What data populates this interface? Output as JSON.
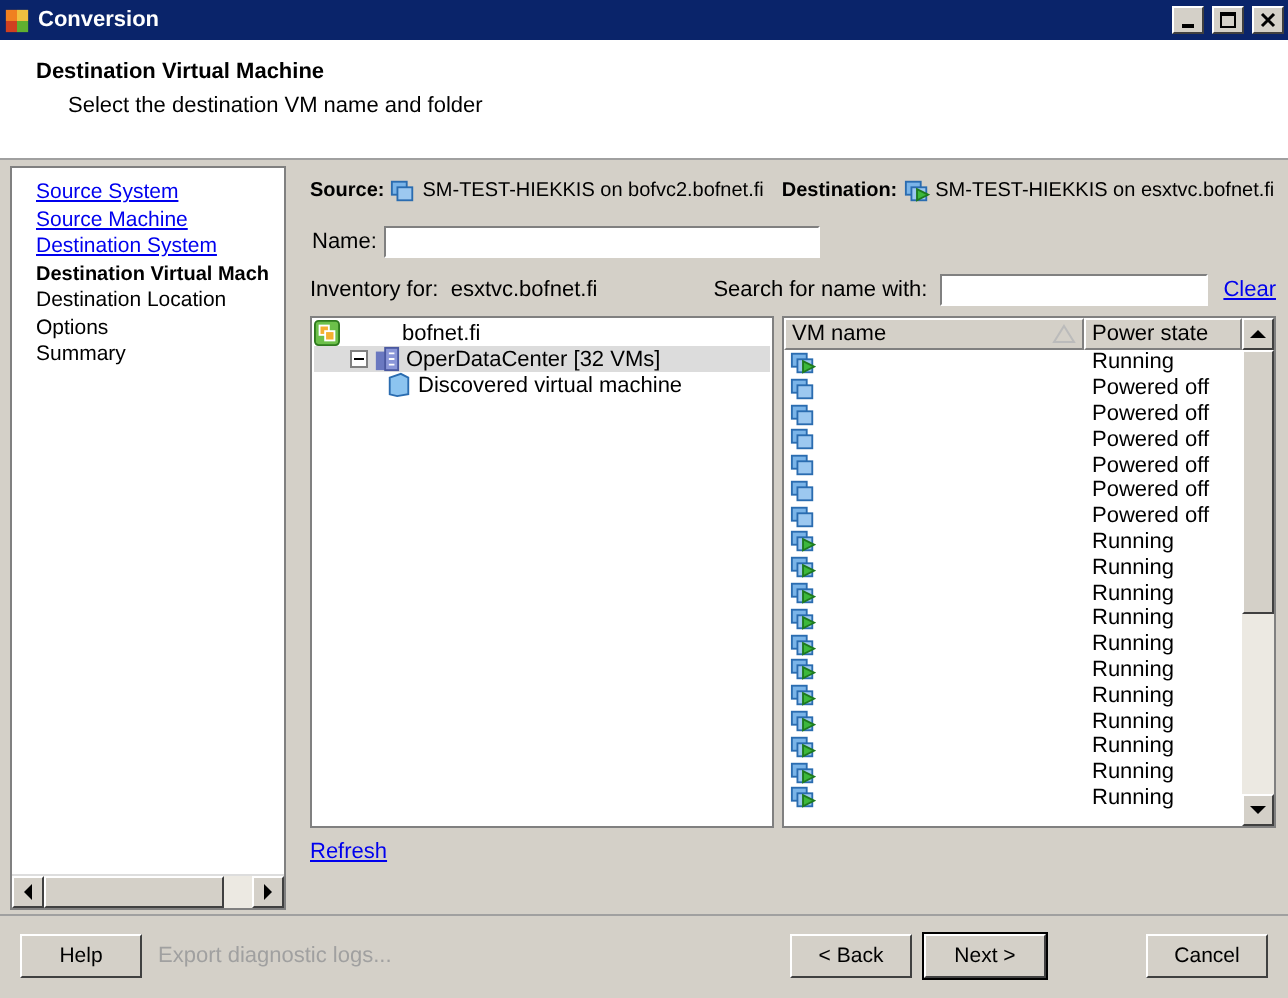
{
  "window": {
    "title": "Conversion"
  },
  "header": {
    "title": "Destination Virtual Machine",
    "subtitle": "Select the destination VM name and folder"
  },
  "steps": [
    {
      "label": "Source System",
      "kind": "link"
    },
    {
      "label": "Source Machine",
      "kind": "link"
    },
    {
      "label": "Destination System",
      "kind": "link"
    },
    {
      "label": "Destination Virtual Mach",
      "kind": "current"
    },
    {
      "label": "Destination Location",
      "kind": "pending"
    },
    {
      "label": "Options",
      "kind": "pending"
    },
    {
      "label": "Summary",
      "kind": "pending"
    }
  ],
  "source": {
    "label": "Source:",
    "value": "SM-TEST-HIEKKIS on bofvc2.bofnet.fi"
  },
  "destination": {
    "label": "Destination:",
    "value": "SM-TEST-HIEKKIS on esxtvc.bofnet.fi"
  },
  "name_field": {
    "label": "Name:"
  },
  "inventory": {
    "label": "Inventory for:",
    "value": "esxtvc.bofnet.fi"
  },
  "search": {
    "label": "Search for name with:",
    "clear": "Clear"
  },
  "tree": [
    {
      "label": "bofnet.fi",
      "kind": "vcenter",
      "selected": false,
      "children": [
        {
          "label": "OperDataCenter [32 VMs]",
          "kind": "datacenter",
          "selected": true,
          "expanded": true,
          "children": [
            {
              "label": "Discovered virtual machine",
              "kind": "folder",
              "selected": false
            }
          ]
        }
      ]
    }
  ],
  "vm_table": {
    "columns": [
      "VM name",
      "Power state"
    ],
    "rows": [
      {
        "state": "Running",
        "kind": "running"
      },
      {
        "state": "Powered off",
        "kind": "off"
      },
      {
        "state": "Powered off",
        "kind": "off"
      },
      {
        "state": "Powered off",
        "kind": "off"
      },
      {
        "state": "Powered off",
        "kind": "off"
      },
      {
        "state": "Powered off",
        "kind": "off"
      },
      {
        "state": "Powered off",
        "kind": "off"
      },
      {
        "state": "Running",
        "kind": "running"
      },
      {
        "state": "Running",
        "kind": "running"
      },
      {
        "state": "Running",
        "kind": "running"
      },
      {
        "state": "Running",
        "kind": "running"
      },
      {
        "state": "Running",
        "kind": "running"
      },
      {
        "state": "Running",
        "kind": "running"
      },
      {
        "state": "Running",
        "kind": "running"
      },
      {
        "state": "Running",
        "kind": "running"
      },
      {
        "state": "Running",
        "kind": "running"
      },
      {
        "state": "Running",
        "kind": "running"
      },
      {
        "state": "Running",
        "kind": "running"
      }
    ]
  },
  "refresh": "Refresh",
  "buttons": {
    "help": "Help",
    "export": "Export diagnostic logs...",
    "back": "< Back",
    "next": "Next >",
    "cancel": "Cancel"
  }
}
